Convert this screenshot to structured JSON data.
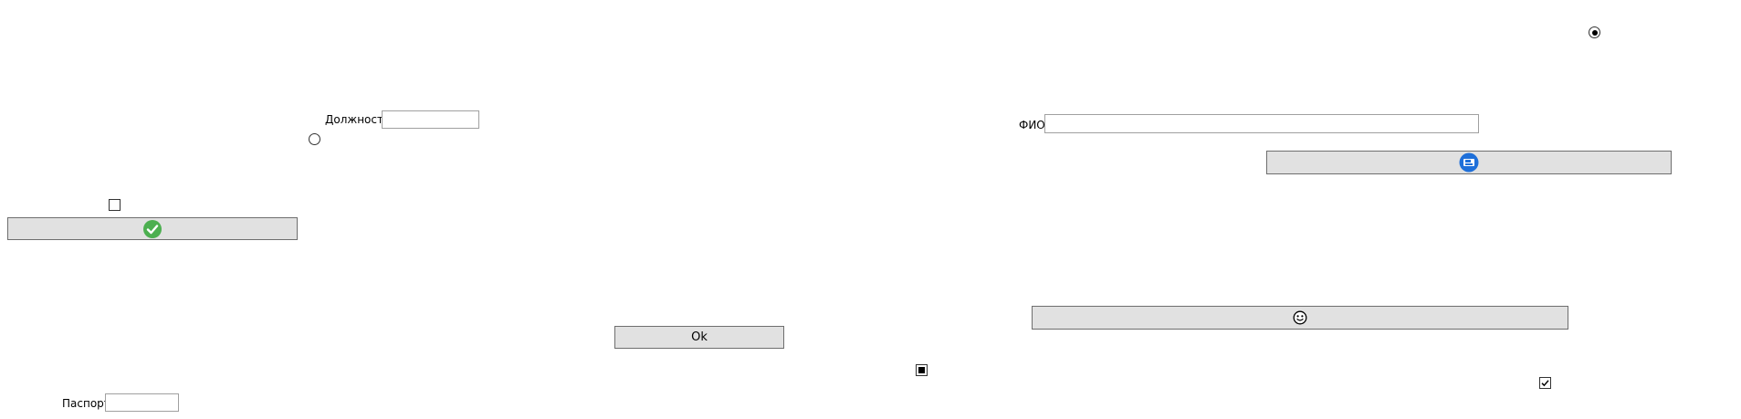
{
  "window": {
    "background": "#ffffff"
  },
  "fields": {
    "position": {
      "label": "Должность",
      "value": ""
    },
    "fio": {
      "label": "ФИО",
      "value": ""
    },
    "passport": {
      "label": "Паспорт",
      "value": ""
    }
  },
  "buttons": {
    "confirm": {
      "label": "",
      "icon": "green-checkmark-icon",
      "icon_color": "#4caf50"
    },
    "save": {
      "label": "",
      "icon": "blue-floppy-icon",
      "icon_color": "#1e6fd9"
    },
    "smiley": {
      "label": "",
      "icon": "smiley-icon"
    },
    "ok": {
      "label": "Ok"
    }
  },
  "radios": {
    "top_right": {
      "checked": true
    },
    "left": {
      "checked": false
    }
  },
  "checkboxes": {
    "left": {
      "state": "unchecked"
    },
    "middle": {
      "state": "indeterminate"
    },
    "right": {
      "state": "checked"
    }
  },
  "colors": {
    "button_face": "#e1e1e1",
    "button_border": "#6e6e6e",
    "textbox_border": "#a0a0a0"
  }
}
